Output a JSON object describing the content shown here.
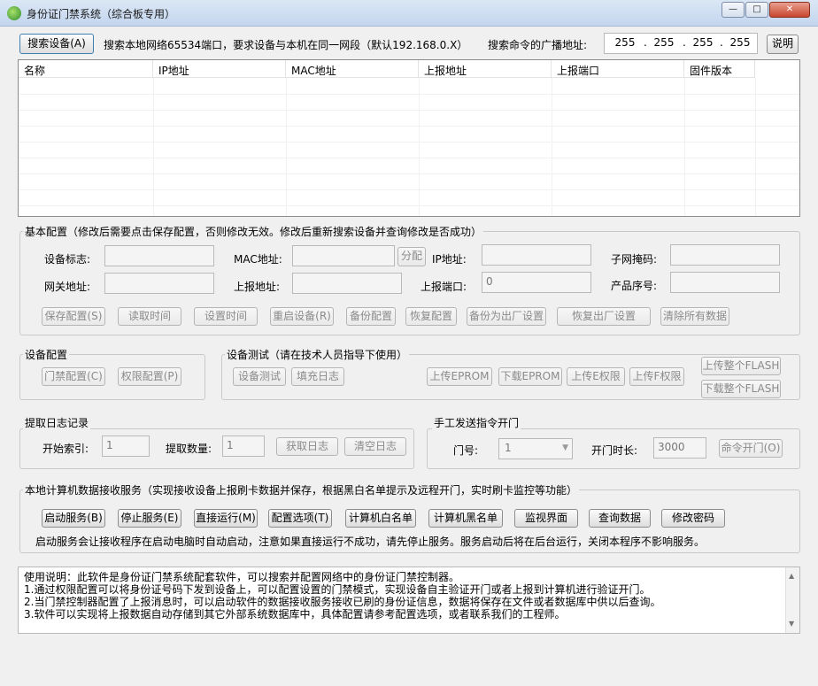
{
  "window": {
    "title": "身份证门禁系统（综合板专用）",
    "min": "—",
    "max": "□",
    "close": "✕"
  },
  "search": {
    "button": "搜索设备(A)",
    "hint": "搜索本地网络65534端口，要求设备与本机在同一网段（默认192.168.0.X）",
    "broadcast_label": "搜索命令的广播地址:",
    "ip": [
      "255",
      "255",
      "255",
      "255"
    ],
    "dot": ".",
    "help_button": "说明"
  },
  "table": {
    "columns": [
      "名称",
      "IP地址",
      "MAC地址",
      "上报地址",
      "上报端口",
      "固件版本"
    ]
  },
  "basic": {
    "title": "基本配置（修改后需要点击保存配置，否则修改无效。修改后重新搜索设备并查询修改是否成功）",
    "labels": {
      "device_id": "设备标志:",
      "mac": "MAC地址:",
      "ip": "IP地址:",
      "subnet": "子网掩码:",
      "gateway": "网关地址:",
      "report_addr": "上报地址:",
      "report_port": "上报端口:",
      "serial": "产品序号:"
    },
    "split_button": "分配",
    "report_port_value": "0",
    "buttons": [
      "保存配置(S)",
      "读取时间",
      "设置时间",
      "重启设备(R)",
      "备份配置",
      "恢复配置",
      "备份为出厂设置",
      "恢复出厂设置",
      "清除所有数据"
    ]
  },
  "device_cfg": {
    "title": "设备配置",
    "buttons": [
      "门禁配置(C)",
      "权限配置(P)"
    ]
  },
  "device_test": {
    "title": "设备测试（请在技术人员指导下使用）",
    "buttons": [
      "设备测试",
      "填充日志",
      "上传EPROM",
      "下载EPROM",
      "上传E权限",
      "上传F权限",
      "上传整个FLASH",
      "下载整个FLASH"
    ]
  },
  "log": {
    "title": "提取日志记录",
    "start_label": "开始索引:",
    "start_value": "1",
    "count_label": "提取数量:",
    "count_value": "1",
    "get_button": "获取日志",
    "clear_button": "清空日志"
  },
  "manual": {
    "title": "手工发送指令开门",
    "door_label": "门号:",
    "door_value": "1",
    "duration_label": "开门时长:",
    "duration_value": "3000",
    "open_button": "命令开门(O)"
  },
  "service": {
    "title": "本地计算机数据接收服务（实现接收设备上报刷卡数据并保存，根据黑白名单提示及远程开门，实时刷卡监控等功能）",
    "buttons": [
      "启动服务(B)",
      "停止服务(E)",
      "直接运行(M)",
      "配置选项(T)",
      "计算机白名单",
      "计算机黑名单",
      "监视界面",
      "查询数据",
      "修改密码"
    ],
    "note": "启动服务会让接收程序在启动电脑时自动启动，注意如果直接运行不成功，请先停止服务。服务启动后将在后台运行，关闭本程序不影响服务。"
  },
  "memo": {
    "lines": [
      "使用说明：此软件是身份证门禁系统配套软件，可以搜索并配置网络中的身份证门禁控制器。",
      "1.通过权限配置可以将身份证号码下发到设备上，可以配置设置的门禁模式，实现设备自主验证开门或者上报到计算机进行验证开门。",
      "2.当门禁控制器配置了上报消息时，可以启动软件的数据接收服务接收已刷的身份证信息，数据将保存在文件或者数据库中供以后查询。",
      "3.软件可以实现将上报数据自动存储到其它外部系统数据库中，具体配置请参考配置选项，或者联系我们的工程师。"
    ]
  },
  "icons": {
    "app": "app-logo-icon",
    "combo": "chevron-down-icon",
    "scroll_up": "arrow-up-icon",
    "scroll_down": "arrow-down-icon"
  }
}
